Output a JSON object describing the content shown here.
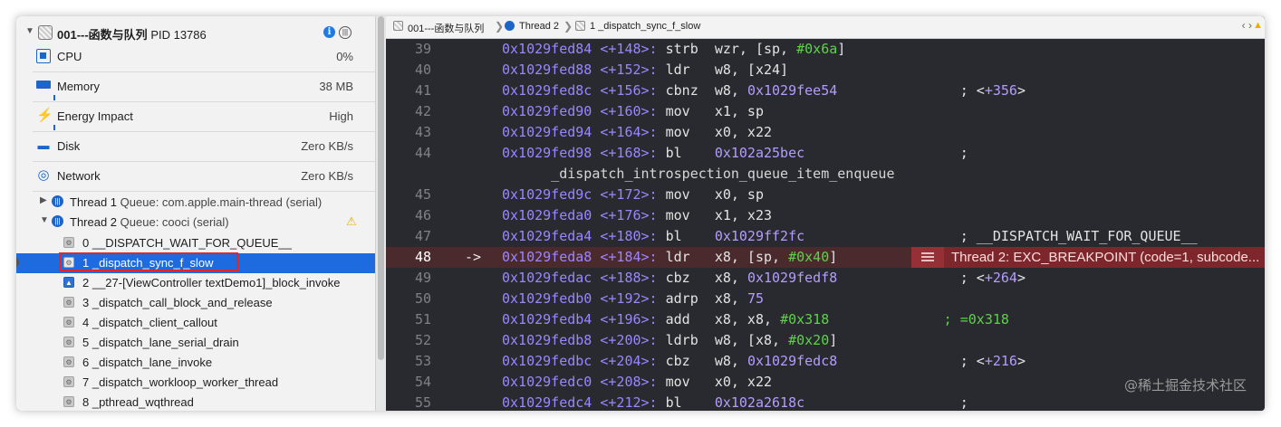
{
  "process": {
    "name": "001---函数与队列",
    "pid": "PID 13786"
  },
  "gauges": [
    {
      "label": "CPU",
      "value": "0%",
      "icon": "cpu-icon"
    },
    {
      "label": "Memory",
      "value": "38 MB",
      "icon": "memory-icon"
    },
    {
      "label": "Energy Impact",
      "value": "High",
      "icon": "energy-icon"
    },
    {
      "label": "Disk",
      "value": "Zero KB/s",
      "icon": "disk-icon"
    },
    {
      "label": "Network",
      "value": "Zero KB/s",
      "icon": "network-icon"
    }
  ],
  "threads": [
    {
      "label": "Thread 1",
      "queue": "Queue: com.apple.main-thread (serial)",
      "expanded": false
    },
    {
      "label": "Thread 2",
      "queue": "Queue: cooci (serial)",
      "expanded": true
    }
  ],
  "frames": [
    {
      "text": "0 __DISPATCH_WAIT_FOR_QUEUE__",
      "user": false,
      "selected": false
    },
    {
      "text": "1 _dispatch_sync_f_slow",
      "user": false,
      "selected": true
    },
    {
      "text": "2 __27-[ViewController textDemo1]_block_invoke",
      "user": true,
      "selected": false
    },
    {
      "text": "3 _dispatch_call_block_and_release",
      "user": false,
      "selected": false
    },
    {
      "text": "4 _dispatch_client_callout",
      "user": false,
      "selected": false
    },
    {
      "text": "5 _dispatch_lane_serial_drain",
      "user": false,
      "selected": false
    },
    {
      "text": "6 _dispatch_lane_invoke",
      "user": false,
      "selected": false
    },
    {
      "text": "7 _dispatch_workloop_worker_thread",
      "user": false,
      "selected": false
    },
    {
      "text": "8 _pthread_wqthread",
      "user": false,
      "selected": false
    }
  ],
  "jumpbar": {
    "project": "001---函数与队列",
    "thread": "Thread 2",
    "frame": "1 _dispatch_sync_f_slow"
  },
  "disassembly": [
    {
      "num": "39",
      "addr": "0x1029fed84",
      "off": "<+148>:",
      "op": "strb",
      "args": [
        {
          "t": "wzr, [sp, ",
          "c": "txt"
        },
        {
          "t": "#0x6a",
          "c": "imm"
        },
        {
          "t": "]",
          "c": "txt"
        }
      ]
    },
    {
      "num": "40",
      "addr": "0x1029fed88",
      "off": "<+152>:",
      "op": "ldr",
      "args": [
        {
          "t": "w8, [x24]",
          "c": "txt"
        }
      ]
    },
    {
      "num": "41",
      "addr": "0x1029fed8c",
      "off": "<+156>:",
      "op": "cbnz",
      "args": [
        {
          "t": "w8, ",
          "c": "txt"
        },
        {
          "t": "0x1029fee54",
          "c": "hex"
        },
        {
          "t": "               ; <",
          "c": "txt"
        },
        {
          "t": "+356",
          "c": "hex"
        },
        {
          "t": ">",
          "c": "txt"
        }
      ]
    },
    {
      "num": "42",
      "addr": "0x1029fed90",
      "off": "<+160>:",
      "op": "mov",
      "args": [
        {
          "t": "x1, sp",
          "c": "txt"
        }
      ]
    },
    {
      "num": "43",
      "addr": "0x1029fed94",
      "off": "<+164>:",
      "op": "mov",
      "args": [
        {
          "t": "x0, x22",
          "c": "txt"
        }
      ]
    },
    {
      "num": "44",
      "addr": "0x1029fed98",
      "off": "<+168>:",
      "op": "bl",
      "args": [
        {
          "t": "0x102a25bec",
          "c": "hex"
        },
        {
          "t": "                   ;",
          "c": "txt"
        }
      ]
    },
    {
      "num": "",
      "wrap": "      _dispatch_introspection_queue_item_enqueue"
    },
    {
      "num": "45",
      "addr": "0x1029fed9c",
      "off": "<+172>:",
      "op": "mov",
      "args": [
        {
          "t": "x0, sp",
          "c": "txt"
        }
      ]
    },
    {
      "num": "46",
      "addr": "0x1029feda0",
      "off": "<+176>:",
      "op": "mov",
      "args": [
        {
          "t": "x1, x23",
          "c": "txt"
        }
      ]
    },
    {
      "num": "47",
      "addr": "0x1029feda4",
      "off": "<+180>:",
      "op": "bl",
      "args": [
        {
          "t": "0x1029ff2fc",
          "c": "hex"
        },
        {
          "t": "                   ; __DISPATCH_WAIT_FOR_QUEUE__",
          "c": "txt"
        }
      ]
    },
    {
      "num": "48",
      "arrow": "->",
      "addr": "0x1029feda8",
      "off": "<+184>:",
      "op": "ldr",
      "args": [
        {
          "t": "x8, [sp, ",
          "c": "txt"
        },
        {
          "t": "#0x40",
          "c": "imm"
        },
        {
          "t": "]",
          "c": "txt"
        }
      ],
      "highlight": true
    },
    {
      "num": "49",
      "addr": "0x1029fedac",
      "off": "<+188>:",
      "op": "cbz",
      "args": [
        {
          "t": "x8, ",
          "c": "txt"
        },
        {
          "t": "0x1029fedf8",
          "c": "hex"
        },
        {
          "t": "               ; <",
          "c": "txt"
        },
        {
          "t": "+264",
          "c": "hex"
        },
        {
          "t": ">",
          "c": "txt"
        }
      ]
    },
    {
      "num": "50",
      "addr": "0x1029fedb0",
      "off": "<+192>:",
      "op": "adrp",
      "args": [
        {
          "t": "x8, ",
          "c": "txt"
        },
        {
          "t": "75",
          "c": "hex"
        }
      ]
    },
    {
      "num": "51",
      "addr": "0x1029fedb4",
      "off": "<+196>:",
      "op": "add",
      "args": [
        {
          "t": "x8, x8, ",
          "c": "txt"
        },
        {
          "t": "#0x318",
          "c": "imm"
        },
        {
          "t": "              ; =0x318",
          "c": "cmt"
        }
      ]
    },
    {
      "num": "52",
      "addr": "0x1029fedb8",
      "off": "<+200>:",
      "op": "ldrb",
      "args": [
        {
          "t": "w8, [x8, ",
          "c": "txt"
        },
        {
          "t": "#0x20",
          "c": "imm"
        },
        {
          "t": "]",
          "c": "txt"
        }
      ]
    },
    {
      "num": "53",
      "addr": "0x1029fedbc",
      "off": "<+204>:",
      "op": "cbz",
      "args": [
        {
          "t": "w8, ",
          "c": "txt"
        },
        {
          "t": "0x1029fedc8",
          "c": "hex"
        },
        {
          "t": "               ; <",
          "c": "txt"
        },
        {
          "t": "+216",
          "c": "hex"
        },
        {
          "t": ">",
          "c": "txt"
        }
      ]
    },
    {
      "num": "54",
      "addr": "0x1029fedc0",
      "off": "<+208>:",
      "op": "mov",
      "args": [
        {
          "t": "x0, x22",
          "c": "txt"
        }
      ]
    },
    {
      "num": "55",
      "addr": "0x1029fedc4",
      "off": "<+212>:",
      "op": "bl",
      "args": [
        {
          "t": "0x102a2618c",
          "c": "hex"
        },
        {
          "t": "                   ;",
          "c": "txt"
        }
      ]
    }
  ],
  "exception": {
    "text": "Thread 2: EXC_BREAKPOINT (code=1, subcode..."
  },
  "watermark": "@稀土掘金技术社区",
  "colors": {
    "selection": "#1e6be0",
    "highlight_row": "#4b2a2d",
    "exception_bg": "#7d262b",
    "red_annotation": "#e0262b"
  }
}
